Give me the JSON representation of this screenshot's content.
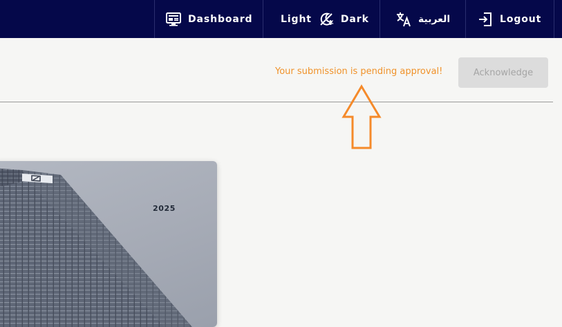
{
  "nav": {
    "dashboard": {
      "label": "Dashboard",
      "icon": "monitor-icon"
    },
    "theme": {
      "light_label": "Light",
      "dark_label": "Dark",
      "icon": "theme-toggle-icon"
    },
    "language": {
      "label": "العربية",
      "icon": "translate-icon"
    },
    "logout": {
      "label": "Logout",
      "icon": "logout-icon"
    },
    "background_color": "#05084a"
  },
  "notice": {
    "message": "Your submission is pending approval!",
    "message_color": "#f0922a",
    "acknowledge_label": "Acknowledge"
  },
  "card": {
    "year": "2025",
    "image": "skyscraper-photo"
  },
  "annotation": {
    "icon": "up-arrow-icon",
    "color": "#f58a2a"
  }
}
